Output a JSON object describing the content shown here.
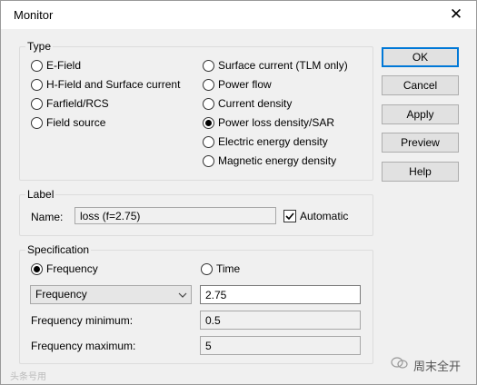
{
  "window": {
    "title": "Monitor"
  },
  "type_group": {
    "label": "Type",
    "options_left": [
      {
        "label": "E-Field",
        "selected": false
      },
      {
        "label": "H-Field and Surface current",
        "selected": false
      },
      {
        "label": "Farfield/RCS",
        "selected": false
      },
      {
        "label": "Field source",
        "selected": false
      }
    ],
    "options_right": [
      {
        "label": "Surface current (TLM only)",
        "selected": false
      },
      {
        "label": "Power flow",
        "selected": false
      },
      {
        "label": "Current density",
        "selected": false
      },
      {
        "label": "Power loss density/SAR",
        "selected": true
      },
      {
        "label": "Electric energy density",
        "selected": false
      },
      {
        "label": "Magnetic energy density",
        "selected": false
      }
    ]
  },
  "label_group": {
    "label": "Label",
    "name_label": "Name:",
    "name_value": "loss (f=2.75)",
    "automatic_label": "Automatic",
    "automatic_checked": true
  },
  "spec_group": {
    "label": "Specification",
    "frequency_radio": "Frequency",
    "time_radio": "Time",
    "mode_selected": "frequency",
    "dropdown_value": "Frequency",
    "frequency_value": "2.75",
    "min_label": "Frequency minimum:",
    "min_value": "0.5",
    "max_label": "Frequency maximum:",
    "max_value": "5"
  },
  "buttons": {
    "ok": "OK",
    "cancel": "Cancel",
    "apply": "Apply",
    "preview": "Preview",
    "help": "Help"
  },
  "watermarks": {
    "right": "周末全开",
    "left": "头条号用"
  }
}
